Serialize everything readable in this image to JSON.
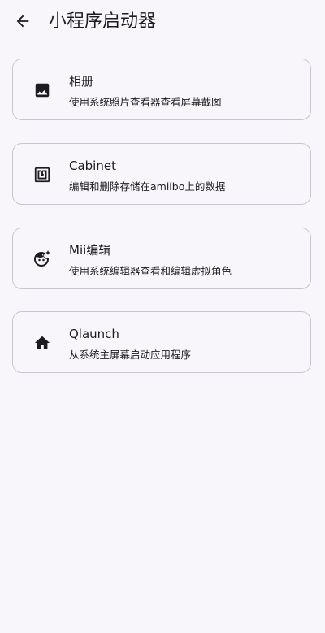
{
  "header": {
    "title": "小程序启动器",
    "back_icon": "arrow-back-icon"
  },
  "applets": [
    {
      "icon": "image-icon",
      "title": "相册",
      "subtitle": "使用系统照片查看器查看屏幕截图"
    },
    {
      "icon": "nfc-icon",
      "title": "Cabinet",
      "subtitle": "编辑和删除存储在amiibo上的数据"
    },
    {
      "icon": "face-icon",
      "title": "Mii编辑",
      "subtitle": "使用系统编辑器查看和编辑虚拟角色"
    },
    {
      "icon": "home-icon",
      "title": "Qlaunch",
      "subtitle": "从系统主屏幕启动应用程序"
    }
  ],
  "colors": {
    "background": "#f8f6fb",
    "card_border": "#cac4d0",
    "text": "#1c1b1f"
  }
}
